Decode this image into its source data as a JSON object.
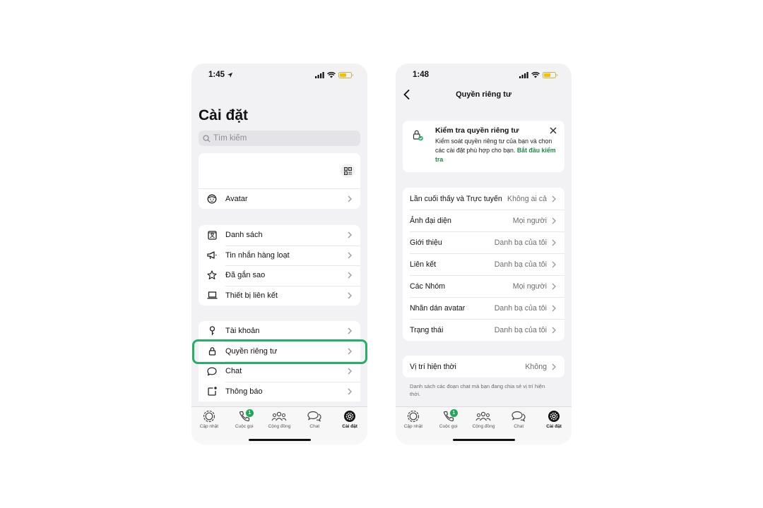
{
  "left_phone": {
    "status_time": "1:45",
    "page_title": "Cài đặt",
    "search_placeholder": "Tìm kiếm",
    "avatar_label": "Avatar",
    "group1": [
      "Danh sách",
      "Tin nhắn hàng loạt",
      "Đã gắn sao",
      "Thiết bị liên kết"
    ],
    "group2": [
      "Tài khoản",
      "Quyền riêng tư",
      "Chat",
      "Thông báo"
    ]
  },
  "right_phone": {
    "status_time": "1:48",
    "nav_title": "Quyền riêng tư",
    "banner": {
      "title": "Kiểm tra quyền riêng tư",
      "description": "Kiểm soát quyền riêng tư của bạn và chọn các cài đặt phù hợp cho bạn.",
      "link": "Bắt đầu kiểm tra"
    },
    "settings": [
      {
        "label": "Lần cuối thấy và Trực tuyến",
        "value": "Không ai cả"
      },
      {
        "label": "Ảnh đại diện",
        "value": "Mọi người"
      },
      {
        "label": "Giới thiệu",
        "value": "Danh bạ của tôi"
      },
      {
        "label": "Liên kết",
        "value": "Danh bạ của tôi"
      },
      {
        "label": "Các Nhóm",
        "value": "Mọi người"
      },
      {
        "label": "Nhãn dán avatar",
        "value": "Danh bạ của tôi"
      },
      {
        "label": "Trạng thái",
        "value": "Danh bạ của tôi"
      }
    ],
    "live_location": {
      "label": "Vị trí hiện thời",
      "value": "Không"
    },
    "footnote": "Danh sách các đoạn chat mà bạn đang chia sẻ vị trí hiện thời."
  },
  "tabbar": {
    "tabs": [
      "Cập nhật",
      "Cuộc gọi",
      "Cộng đồng",
      "Chat",
      "Cài đặt"
    ],
    "calls_badge": "1"
  },
  "colors": {
    "accent": "#25b068",
    "badge": "#1fa855",
    "link": "#1b8a4c"
  },
  "icons": [
    "location-arrow-icon",
    "signal-icon",
    "wifi-icon",
    "battery-icon",
    "search-icon",
    "qr-code-icon",
    "avatar-icon",
    "list-icon",
    "megaphone-icon",
    "star-icon",
    "laptop-icon",
    "key-icon",
    "lock-icon",
    "chat-bubble-icon",
    "notification-icon",
    "chevron-right-icon",
    "back-chevron-icon",
    "close-icon",
    "status-icon",
    "phone-icon",
    "community-icon",
    "settings-gear-icon"
  ]
}
